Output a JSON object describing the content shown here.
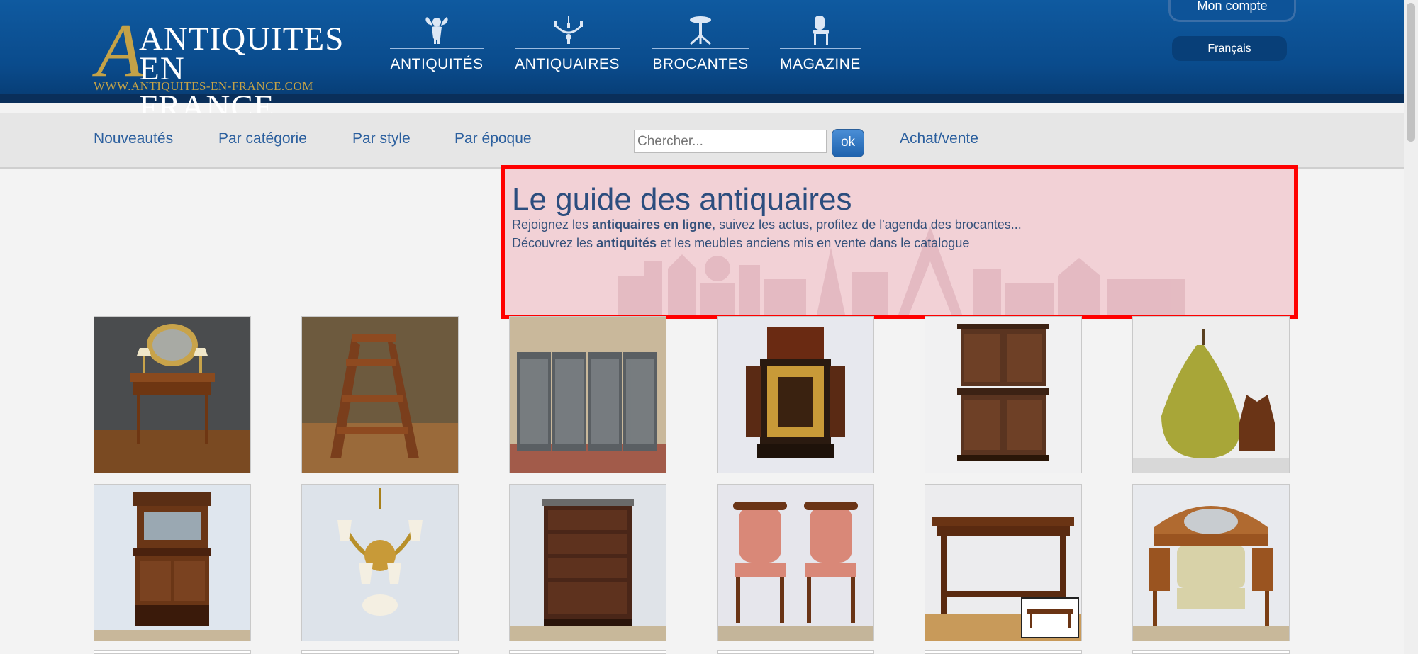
{
  "header": {
    "logo": {
      "line1": "ANTIQUITES",
      "line2": "EN FRANCE",
      "url": "WWW.ANTIQUITES-EN-FRANCE.COM"
    },
    "nav": [
      {
        "label": "ANTIQUITÉS",
        "icon": "cherub-icon"
      },
      {
        "label": "ANTIQUAIRES",
        "icon": "chandelier-icon"
      },
      {
        "label": "BROCANTES",
        "icon": "pedestal-table-icon"
      },
      {
        "label": "MAGAZINE",
        "icon": "chair-icon"
      }
    ],
    "account_label": "Mon compte",
    "language_label": "Français"
  },
  "subnav": {
    "items": [
      "Nouveautés",
      "Par catégorie",
      "Par style",
      "Par époque"
    ],
    "search_placeholder": "Chercher...",
    "search_button": "ok",
    "buy_sell": "Achat/vente"
  },
  "hero": {
    "title": "Le guide des antiquaires",
    "line1": {
      "before": "Rejoignez les ",
      "bold": "antiquaires en ligne",
      "after": ", suivez les actus, profitez de l'agenda des brocantes..."
    },
    "line2": {
      "before": "Découvrez les ",
      "bold": "antiquités",
      "after": " et les meubles anciens mis en vente dans le catalogue"
    }
  },
  "products": [
    {
      "name": "bureau-plat-writing-desk",
      "bg": "#4a4c4e"
    },
    {
      "name": "library-step-ladder",
      "bg": "#6d5a3e"
    },
    {
      "name": "folding-screen",
      "bg": "#c9b89b"
    },
    {
      "name": "boulle-cabinet",
      "bg": "#e7e8ee"
    },
    {
      "name": "inlaid-buffet",
      "bg": "#f1f1f2"
    },
    {
      "name": "pear-and-dog-sculpture",
      "bg": "#eeeeee"
    },
    {
      "name": "mirrored-sideboard",
      "bg": "#dfe6ee"
    },
    {
      "name": "bronze-chandelier",
      "bg": "#dde3ea"
    },
    {
      "name": "chest-of-drawers",
      "bg": "#dfe3e8"
    },
    {
      "name": "pair-of-armchairs",
      "bg": "#e6e6ec"
    },
    {
      "name": "oak-table",
      "bg": "#ececee"
    },
    {
      "name": "dressing-table-bench",
      "bg": "#e8eaee"
    }
  ]
}
